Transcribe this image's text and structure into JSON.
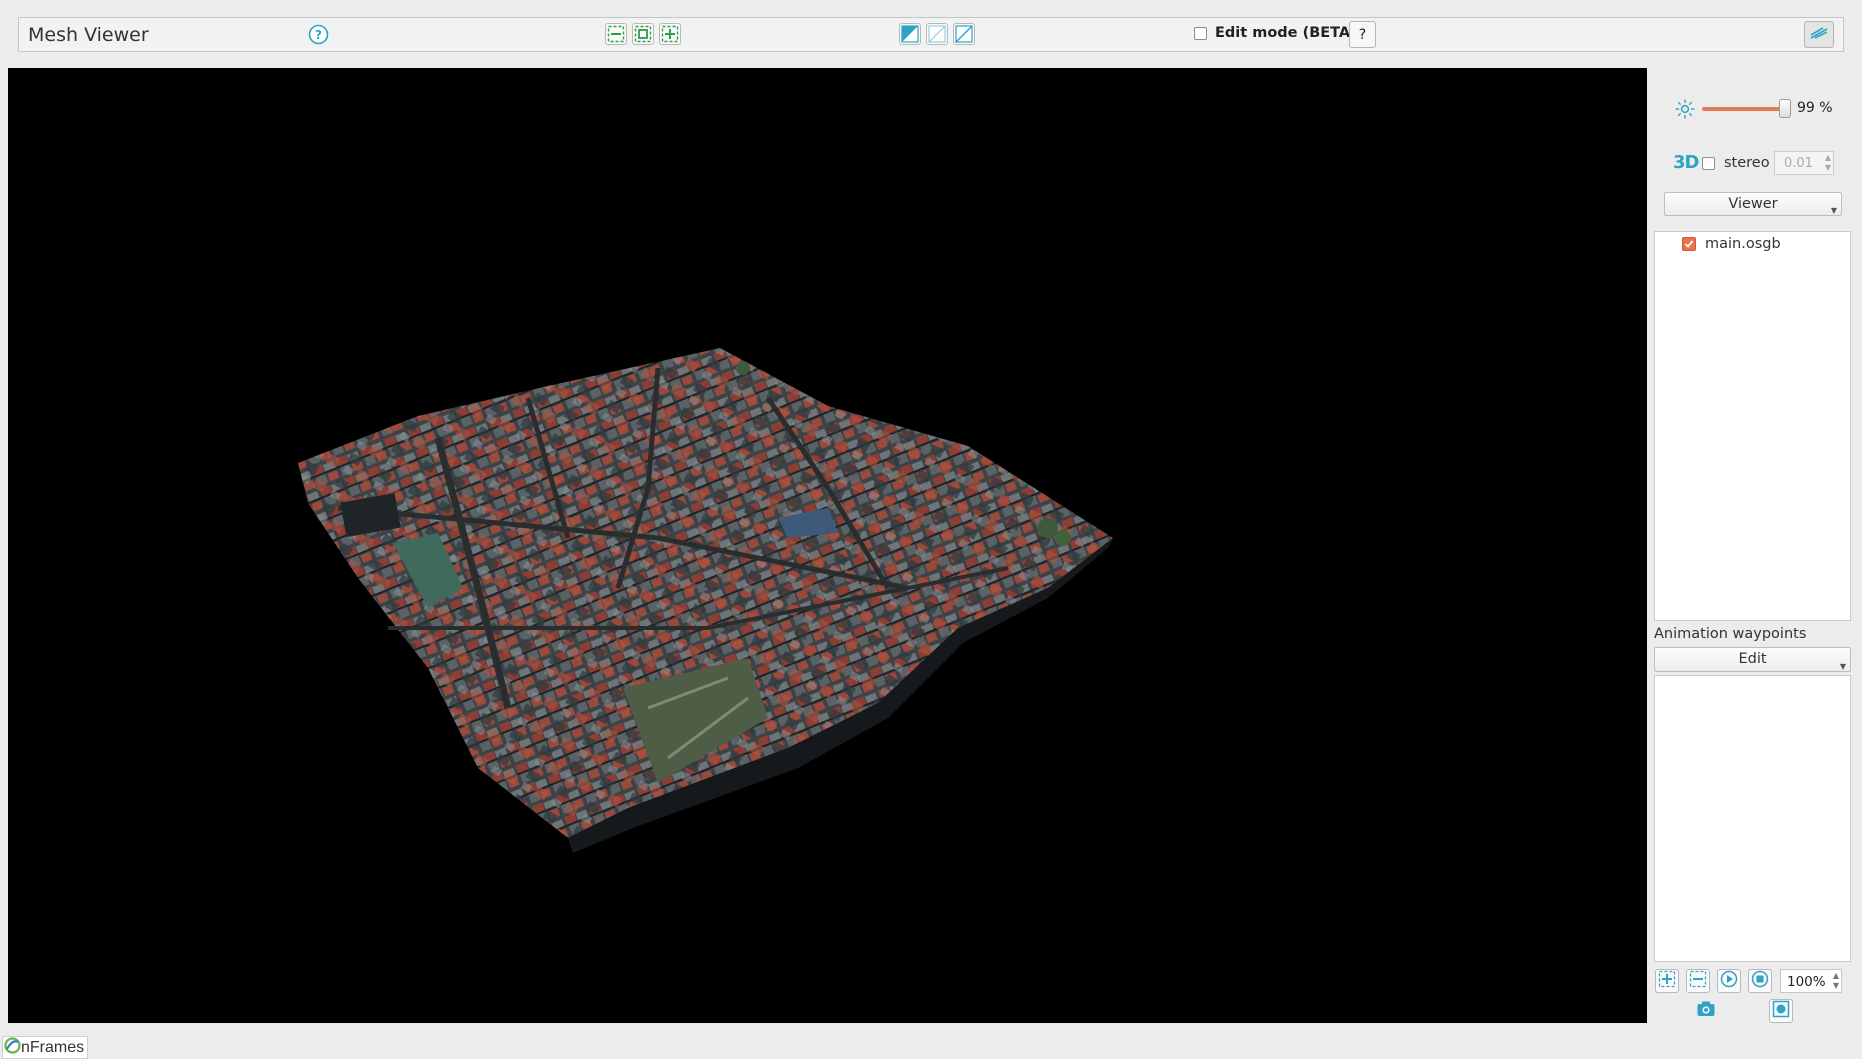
{
  "app": {
    "title": "Mesh Viewer"
  },
  "toolbar": {
    "help_icon": "question-circle-icon",
    "zoom_buttons": [
      "zoom-out-icon",
      "fit-view-icon",
      "zoom-in-icon"
    ],
    "shading_buttons": [
      "shaded-solid-icon",
      "wireframe-light-icon",
      "wireframe-icon"
    ],
    "edit_mode_label": "Edit mode (BETA)",
    "edit_mode_checked": false,
    "edit_help_label": "?",
    "panel_toggle_icon": "collapse-panel-icon"
  },
  "viewport": {
    "content": "3D city mesh"
  },
  "panel": {
    "brightness_icon": "sun-icon",
    "brightness_value": "99 %",
    "brightness_fraction": 0.99,
    "stereo_icon_label": "3D",
    "stereo_label": "stereo",
    "stereo_checked": false,
    "stereo_value": "0.01",
    "mode_select": "Viewer",
    "layers": [
      {
        "name": "main.osgb",
        "checked": true
      }
    ],
    "animation_label": "Animation waypoints",
    "animation_select": "Edit",
    "waypoint_buttons": [
      "add-waypoint-icon",
      "remove-waypoint-icon",
      "play-icon",
      "stop-icon"
    ],
    "zoom_value": "100%",
    "bottom_buttons": [
      "camera-icon",
      "screenshot-icon"
    ]
  },
  "footer": {
    "logo_text": "nFrames"
  },
  "colors": {
    "accent": "#2fa3c6",
    "slider": "#e07a55",
    "check": "#e8744b",
    "green_icon": "#2a9e4c"
  }
}
